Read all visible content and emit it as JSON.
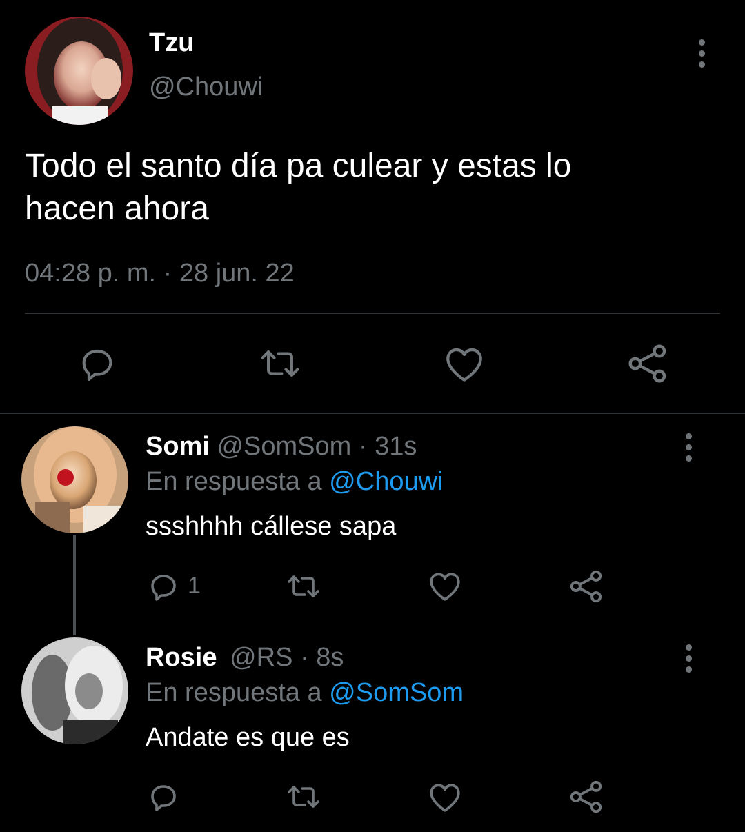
{
  "main_tweet": {
    "display_name": "Tzu",
    "handle": "@Chouwi",
    "text_line1": "Todo el santo día pa culear y estas lo",
    "text_line2": "hacen ahora",
    "timestamp": "04:28 p. m. · 28 jun. 22",
    "avatar_icon": "profile-photo"
  },
  "replies": [
    {
      "display_name": "Somi",
      "handle": "@SomSom",
      "time": "· 31s",
      "reply_prefix": "En respuesta a",
      "reply_to": "@Chouwi",
      "text": "ssshhhh cállese sapa",
      "reply_count": "1"
    },
    {
      "display_name": "Rosie",
      "handle": "@RS",
      "time": "· 8s",
      "reply_prefix": "En respuesta a",
      "reply_to": "@SomSom",
      "text": "Andate es que es",
      "reply_count": ""
    }
  ],
  "colors": {
    "background": "#000000",
    "text": "#e7e9ea",
    "muted": "#71767b",
    "link": "#1d9bf0",
    "divider": "#2f3336"
  },
  "icons": [
    "reply-icon",
    "retweet-icon",
    "like-icon",
    "share-icon",
    "more-options-icon"
  ]
}
